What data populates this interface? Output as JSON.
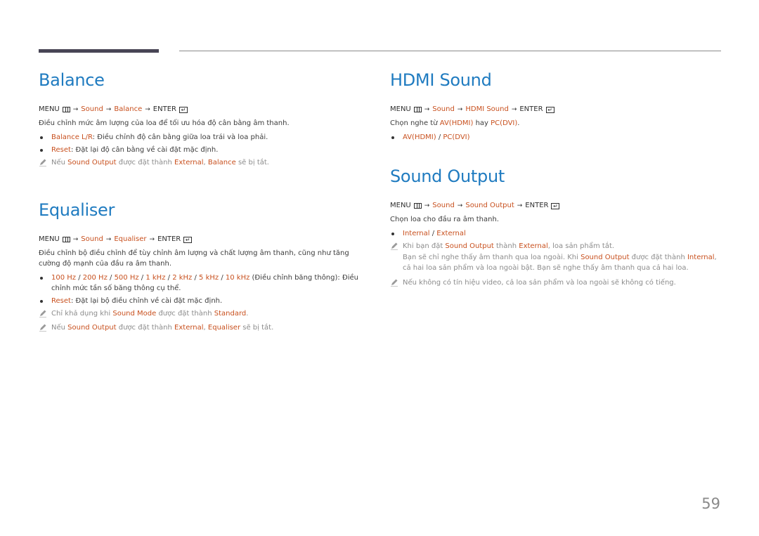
{
  "page_number": "59",
  "path_common": {
    "menu": "MENU",
    "arrow": "→",
    "enter": "ENTER"
  },
  "left": {
    "balance": {
      "title": "Balance",
      "path": [
        "Sound",
        "Balance"
      ],
      "description": "Điều chỉnh mức âm lượng của loa để tối ưu hóa độ cân bằng âm thanh.",
      "bullets": [
        {
          "term": "Balance L/R",
          "text": ": Điều chỉnh độ cân bằng giữa loa trái và loa phải."
        },
        {
          "term": "Reset",
          "text": ": Đặt lại độ cân bằng về cài đặt mặc định."
        }
      ],
      "note": {
        "p1": "Nếu ",
        "hl1": "Sound Output",
        "p2": " được đặt thành ",
        "hl2": "External",
        "p3": ", ",
        "hl3": "Balance",
        "p4": " sẽ bị tắt."
      }
    },
    "equaliser": {
      "title": "Equaliser",
      "path": [
        "Sound",
        "Equaliser"
      ],
      "description": "Điều chỉnh bộ điều chỉnh để tùy chỉnh âm lượng và chất lượng âm thanh, cũng như tăng cường độ mạnh của đầu ra âm thanh.",
      "bands": [
        "100 Hz",
        "200 Hz",
        "500 Hz",
        "1 kHz",
        "2 kHz",
        "5 kHz",
        "10 kHz"
      ],
      "bands_sep": " / ",
      "bands_text": " (Điều chỉnh băng thông): Điều chỉnh mức tần số băng thông cụ thể.",
      "reset": {
        "term": "Reset",
        "text": ": Đặt lại bộ điều chỉnh về cài đặt mặc định."
      },
      "note1": {
        "p1": "Chỉ khả dụng khi ",
        "hl1": "Sound Mode",
        "p2": " được đặt thành ",
        "hl2": "Standard",
        "p3": "."
      },
      "note2": {
        "p1": "Nếu ",
        "hl1": "Sound Output",
        "p2": " được đặt thành ",
        "hl2": "External",
        "p3": ", ",
        "hl3": "Equaliser",
        "p4": " sẽ bị tắt."
      }
    }
  },
  "right": {
    "hdmi": {
      "title": "HDMI Sound",
      "path": [
        "Sound",
        "HDMI Sound"
      ],
      "desc": {
        "p1": "Chọn nghe từ ",
        "hl1": "AV(HDMI)",
        "p2": " hay ",
        "hl2": "PC(DVI)",
        "p3": "."
      },
      "options": [
        "AV(HDMI)",
        "PC(DVI)"
      ],
      "options_sep": " / "
    },
    "sound_output": {
      "title": "Sound Output",
      "path": [
        "Sound",
        "Sound Output"
      ],
      "description": "Chọn loa cho đầu ra âm thanh.",
      "options": [
        "Internal",
        "External"
      ],
      "options_sep": " / ",
      "note1": {
        "p1": "Khi bạn đặt ",
        "hl1": "Sound Output",
        "p2": " thành ",
        "hl2": "External",
        "p3": ", loa sản phẩm tắt.",
        "s1": "Bạn sẽ chỉ nghe thấy âm thanh qua loa ngoài. Khi ",
        "shl1": "Sound Output",
        "s2": " được đặt thành ",
        "shl2": "Internal",
        "s3": ", cả hai loa sản phẩm và loa ngoài bật. Bạn sẽ nghe thấy âm thanh qua cả hai loa."
      },
      "note2": "Nếu không có tín hiệu video, cả loa sản phẩm và loa ngoài sẽ không có tiếng."
    }
  },
  "colors": {
    "heading": "#1f7bc0",
    "highlight": "#c8501e",
    "note_text": "#8c8c8c"
  }
}
